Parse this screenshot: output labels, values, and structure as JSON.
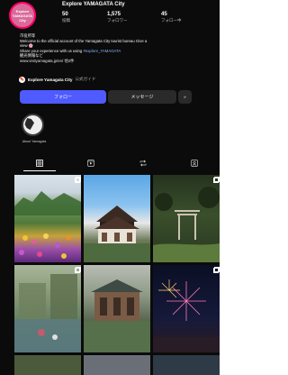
{
  "profile": {
    "avatar_lines": [
      "Explore",
      "YAMAGATA",
      "City"
    ],
    "username": "Explore YAMAGATA City",
    "stats": [
      {
        "value": "50",
        "label": "投稿"
      },
      {
        "value": "1,575",
        "label": "フォロワー"
      },
      {
        "value": "45",
        "label": "フォロー中"
      }
    ],
    "bio_lines": [
      "市役所等",
      "Welcome to the official account of the Yamagata City tourist bureau Give a",
      "view 🌸",
      "Share your experience with us using",
      "観光情報など",
      "www.visityamagata.jp/en/ 他2件"
    ],
    "bio_hashtag": "#explore_YAMAGATA",
    "guide": {
      "badge": "🔖",
      "title": "Explore Yamagata City",
      "subtitle": "公式ガイド"
    }
  },
  "actions": {
    "follow": "フォロー",
    "message": "メッセージ",
    "add": "+"
  },
  "highlight": {
    "label": "About Yamagata"
  },
  "tabs": [
    {
      "name": "grid",
      "icon": "grid-icon"
    },
    {
      "name": "reels",
      "icon": "reels-icon"
    },
    {
      "name": "reposts",
      "icon": "repost-icon"
    },
    {
      "name": "tagged",
      "icon": "tagged-icon"
    }
  ],
  "colors": {
    "follow": "#4f5bff",
    "background": "#0b0b0b",
    "surface": "#2a2a2a"
  },
  "posts": [
    {
      "name": "post-flower-field",
      "multi": true
    },
    {
      "name": "post-temple",
      "multi": false
    },
    {
      "name": "post-forest-shrine",
      "multi": false
    },
    {
      "name": "post-lake-rain",
      "multi": true
    },
    {
      "name": "post-old-building",
      "multi": false
    },
    {
      "name": "post-fireworks",
      "multi": true
    },
    {
      "name": "post-partial-1",
      "multi": false
    },
    {
      "name": "post-partial-2",
      "multi": false
    },
    {
      "name": "post-partial-3",
      "multi": false
    }
  ]
}
